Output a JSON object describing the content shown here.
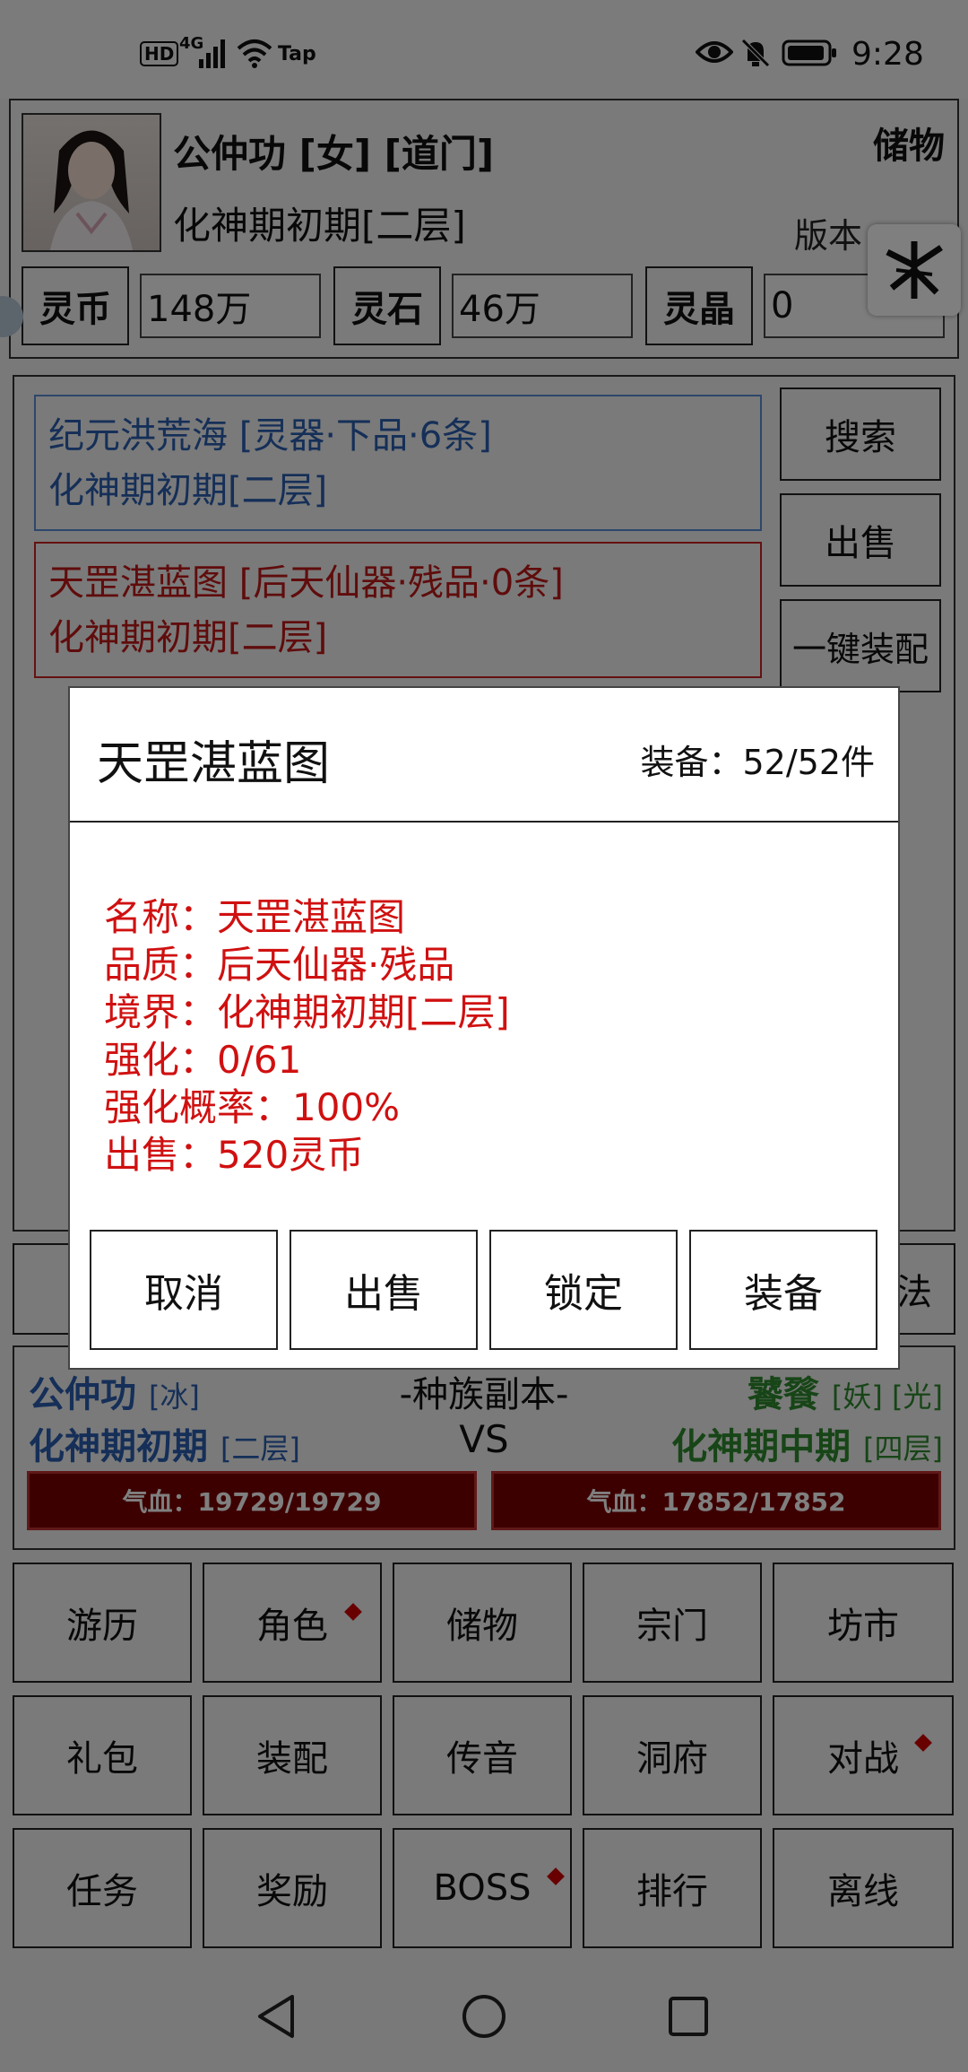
{
  "status_bar": {
    "left_icons": [
      "HD",
      "4G",
      "signal-icon",
      "wifi-icon",
      "Tap"
    ],
    "time": "9:28",
    "right_icons": [
      "eye-icon",
      "bell-off-icon",
      "battery-icon"
    ]
  },
  "header": {
    "name": "公仲功 [女] [道门]",
    "realm": "化神期初期[二层]",
    "storage_title": "储物",
    "version": "版本",
    "currencies": [
      {
        "label": "灵币",
        "value": "148万"
      },
      {
        "label": "灵石",
        "value": "46万"
      },
      {
        "label": "灵晶",
        "value": "0"
      }
    ]
  },
  "inventory": {
    "items": [
      {
        "line1": "纪元洪荒海 [灵器·下品·6条]",
        "line2": "化神期初期[二层]",
        "color": "#2a5fb0"
      },
      {
        "line1": "天罡湛蓝图 [后天仙器·残品·0条]",
        "line2": "化神期初期[二层]",
        "color": "#c01818"
      }
    ],
    "side_buttons": [
      "搜索",
      "出售",
      "一键装配"
    ],
    "partial_tab_label": "法"
  },
  "battle": {
    "player_name": "公仲功",
    "player_tag": "[冰]",
    "player_realm": "化神期初期",
    "player_layer": "[二层]",
    "title": "-种族副本-",
    "vs": "VS",
    "enemy_name": "饕餮",
    "enemy_tag": "[妖] [光]",
    "enemy_realm": "化神期中期",
    "enemy_layer": "[四层]",
    "player_hp": "气血：19729/19729",
    "enemy_hp": "气血：17852/17852",
    "player_color": "#2a5fb0",
    "enemy_color": "#2e8a2e"
  },
  "menu": {
    "rows": [
      [
        "游历",
        "角色",
        "储物",
        "宗门",
        "坊市"
      ],
      [
        "礼包",
        "装配",
        "传音",
        "洞府",
        "对战"
      ],
      [
        "任务",
        "奖励",
        "BOSS",
        "排行",
        "离线"
      ]
    ]
  },
  "dialog": {
    "title": "天罡湛蓝图",
    "count": "装备：52/52件",
    "details": [
      "名称：天罡湛蓝图",
      "品质：后天仙器·残品",
      "境界：化神期初期[二层]",
      "强化：0/61",
      "强化概率：100%",
      "出售：520灵币"
    ],
    "buttons": [
      "取消",
      "出售",
      "锁定",
      "装备"
    ]
  },
  "navbar": {
    "icons": [
      "back-icon",
      "home-icon",
      "recents-icon"
    ]
  }
}
